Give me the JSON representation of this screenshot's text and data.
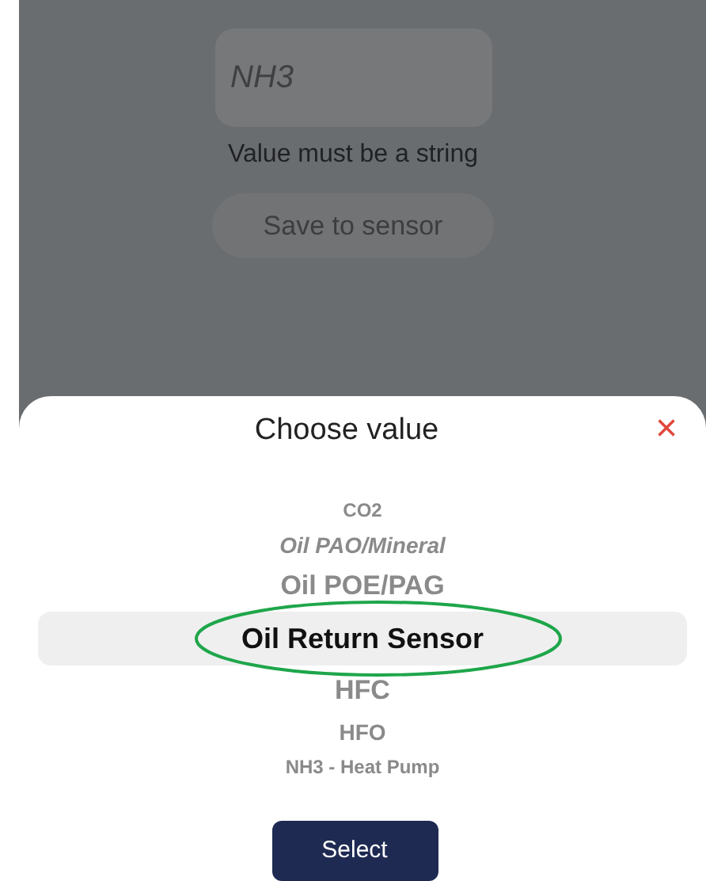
{
  "form": {
    "field": {
      "placeholder": "NH3"
    },
    "error": "Value must be a string",
    "save_button": {
      "label": "Save to sensor",
      "disabled": true
    }
  },
  "sheet": {
    "title": "Choose value",
    "close": "×",
    "options": [
      {
        "label": "CO2",
        "selected": false
      },
      {
        "label": "Oil PAO/Mineral",
        "selected": false
      },
      {
        "label": "Oil POE/PAG",
        "selected": false
      },
      {
        "label": "Oil Return Sensor",
        "selected": true
      },
      {
        "label": "HFC",
        "selected": false
      },
      {
        "label": "HFO",
        "selected": false
      },
      {
        "label": "NH3 - Heat Pump",
        "selected": false
      }
    ],
    "select_button": "Select"
  }
}
